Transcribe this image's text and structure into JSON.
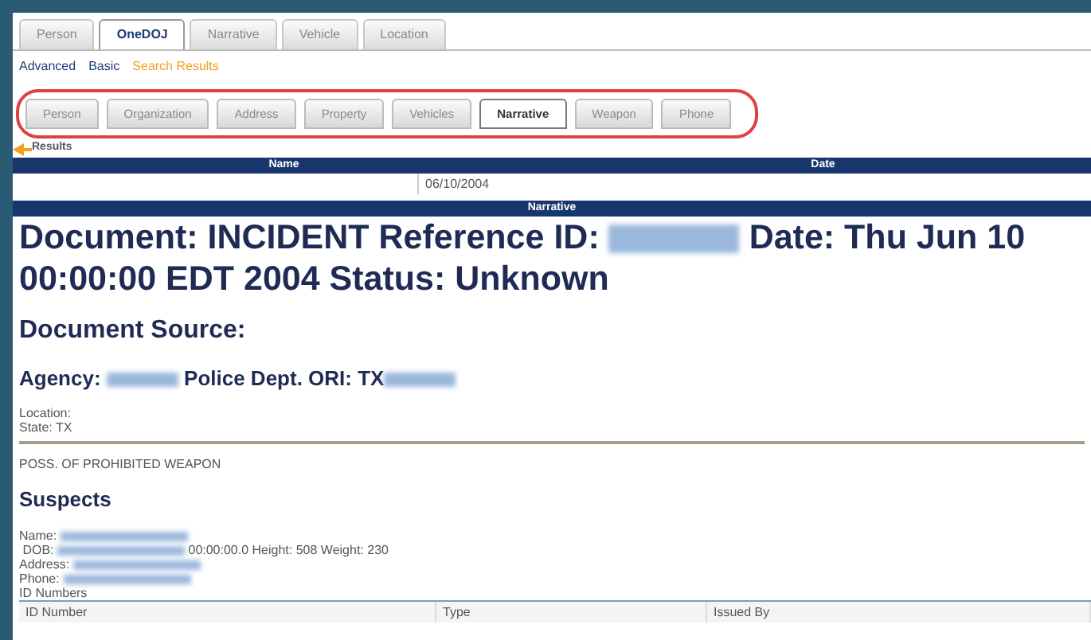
{
  "top_tabs": [
    {
      "label": "Person",
      "selected": false
    },
    {
      "label": "OneDOJ",
      "selected": true
    },
    {
      "label": "Narrative",
      "selected": false
    },
    {
      "label": "Vehicle",
      "selected": false
    },
    {
      "label": "Location",
      "selected": false
    }
  ],
  "sub_links": [
    {
      "label": "Advanced",
      "selected": false
    },
    {
      "label": "Basic",
      "selected": false
    },
    {
      "label": "Search Results",
      "selected": true
    }
  ],
  "result_tabs": [
    {
      "label": "Person",
      "selected": false
    },
    {
      "label": "Organization",
      "selected": false
    },
    {
      "label": "Address",
      "selected": false
    },
    {
      "label": "Property",
      "selected": false
    },
    {
      "label": "Vehicles",
      "selected": false
    },
    {
      "label": "Narrative",
      "selected": true
    },
    {
      "label": "Weapon",
      "selected": false
    },
    {
      "label": "Phone",
      "selected": false
    }
  ],
  "results_label": "Results",
  "results_table": {
    "columns": [
      "Name",
      "Date"
    ],
    "rows": [
      {
        "date": "06/10/2004"
      }
    ]
  },
  "narrative_header": "Narrative",
  "title_segments": [
    {
      "kind": "text",
      "text": "Document: INCIDENT Reference ID: "
    },
    {
      "kind": "redacted"
    },
    {
      "kind": "text",
      "text": " Date: Thu Jun 10 00:00:00 EDT 2004 Status: Unknown"
    }
  ],
  "source_heading": "Document Source:",
  "agency_segments": [
    {
      "kind": "text",
      "text": "Agency: "
    },
    {
      "kind": "redacted"
    },
    {
      "kind": "text",
      "text": " Police Dept.  ORI: TX"
    },
    {
      "kind": "redacted"
    }
  ],
  "location_lines": [
    "Location:",
    "State: TX"
  ],
  "offense": "POSS. OF PROHIBITED WEAPON",
  "suspects_heading": "Suspects",
  "suspect_lines": [
    [
      {
        "kind": "text",
        "text": "Name: "
      },
      {
        "kind": "redacted"
      }
    ],
    [
      {
        "kind": "text",
        "text": " DOB: "
      },
      {
        "kind": "redacted"
      },
      {
        "kind": "text",
        "text": " 00:00:00.0 Height: 508 Weight: 230"
      }
    ],
    [
      {
        "kind": "text",
        "text": "Address: "
      },
      {
        "kind": "redacted"
      }
    ],
    [
      {
        "kind": "text",
        "text": "Phone: "
      },
      {
        "kind": "redacted"
      }
    ],
    [
      {
        "kind": "text",
        "text": "ID Numbers"
      }
    ]
  ],
  "id_table": {
    "columns": [
      "ID Number",
      "Type",
      "Issued By"
    ]
  }
}
